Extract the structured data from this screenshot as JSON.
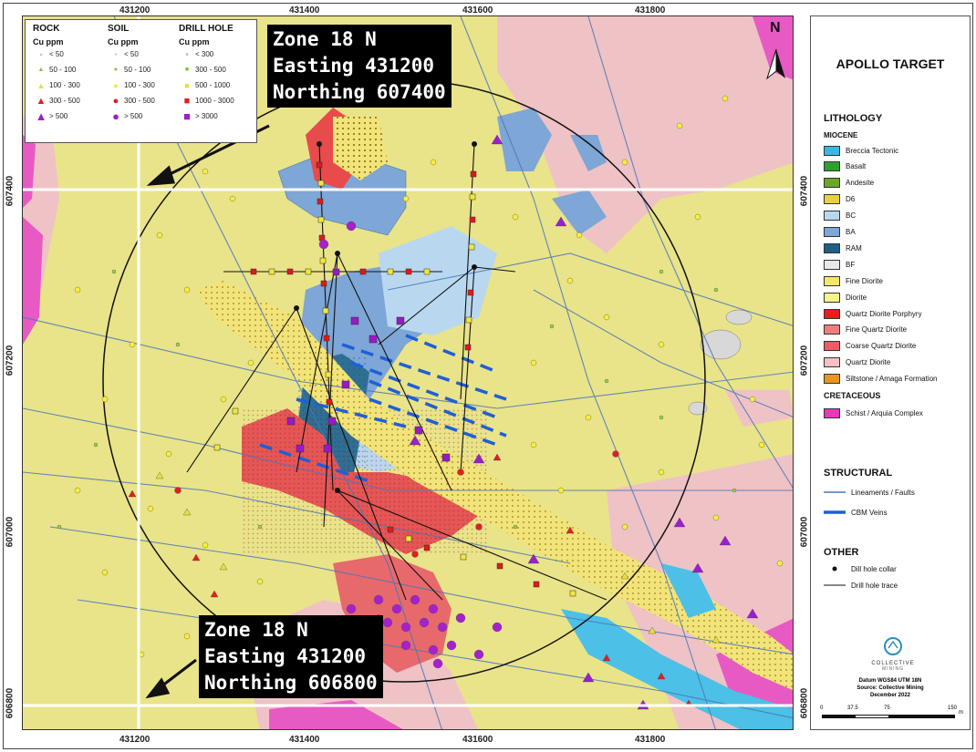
{
  "axes": {
    "x_ticks": [
      "431200",
      "431400",
      "431600",
      "431800"
    ],
    "y_ticks": [
      "607400",
      "607200",
      "607000",
      "606800"
    ]
  },
  "north_label": "N",
  "callouts": [
    {
      "lines": [
        "Zone 18 N",
        "Easting 431200",
        "Northing 607400"
      ]
    },
    {
      "lines": [
        "Zone 18 N",
        "Easting 431200",
        "Northing 606800"
      ]
    }
  ],
  "sample_legend": {
    "rock": {
      "title": "ROCK",
      "unit": "Cu ppm",
      "items": [
        "< 50",
        "50 - 100",
        "100 - 300",
        "300 - 500",
        "> 500"
      ]
    },
    "soil": {
      "title": "SOIL",
      "unit": "Cu ppm",
      "items": [
        "< 50",
        "50 - 100",
        "100 - 300",
        "300 - 500",
        "> 500"
      ]
    },
    "drill": {
      "title": "DRILL HOLE",
      "unit": "Cu ppm",
      "items": [
        "< 300",
        "300 - 500",
        "500 - 1000",
        "1000 - 3000",
        "> 3000"
      ]
    }
  },
  "legend": {
    "title": "APOLLO TARGET",
    "lithology_title": "LITHOLOGY",
    "miocene_title": "MIOCENE",
    "miocene_items": [
      {
        "label": "Breccia Tectonic",
        "color": "#39b8e0"
      },
      {
        "label": "Basalt",
        "color": "#2ea02e"
      },
      {
        "label": "Andesite",
        "color": "#6aa629"
      },
      {
        "label": "D6",
        "color": "#e6d23a"
      },
      {
        "label": "BC",
        "color": "#b9d8ef"
      },
      {
        "label": "BA",
        "color": "#7ea6d6"
      },
      {
        "label": "RAM",
        "color": "#1f5f86"
      },
      {
        "label": "BF",
        "color": "#e8e8e8"
      },
      {
        "label": "Fine Diorite",
        "color": "#f5e66a"
      },
      {
        "label": "Diorite",
        "color": "#f7f28a"
      },
      {
        "label": "Quartz Diorite Porphyry",
        "color": "#e0221f"
      },
      {
        "label": "Fine Quartz Diorite",
        "color": "#f27c7c"
      },
      {
        "label": "Coarse Quartz Diorite",
        "color": "#ef5c62"
      },
      {
        "label": "Quartz Diorite",
        "color": "#f6c0c6"
      },
      {
        "label": "Siltstone / Amaga Formation",
        "color": "#e8961e"
      }
    ],
    "cretaceous_title": "CRETACEOUS",
    "cretaceous_items": [
      {
        "label": "Schist / Arquia Complex",
        "color": "#e83ab8"
      }
    ],
    "structural_title": "STRUCTURAL",
    "structural_items": [
      "Lineaments / Faults",
      "CBM Veins"
    ],
    "other_title": "OTHER",
    "other_items": [
      "Dill hole collar",
      "Drill hole trace"
    ],
    "logo_text": "COLLECTIVE",
    "logo_sub": "MINING",
    "datum": "Datum WGS84 UTM 18N",
    "source": "Source: Collective Mining",
    "date": "December 2022",
    "scale_ticks": [
      "0",
      "37.5",
      "75",
      "150"
    ],
    "scale_unit": "m"
  }
}
